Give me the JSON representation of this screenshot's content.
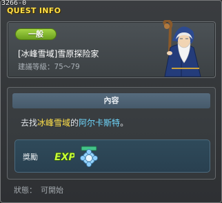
{
  "window": {
    "quest_id": "3266-0",
    "title": "QUEST INFO"
  },
  "header": {
    "category": "一般",
    "quest_name": "[冰峰雪域]雪原探险家",
    "recommend_label": "建議等級：",
    "recommend_range": "75～79",
    "npc_icon": "old-wizard-npc"
  },
  "content": {
    "heading": "內容",
    "text_prefix": "去找",
    "location": "冰峰雪域",
    "text_mid": "的",
    "npc_name": "阿尔卡斯特",
    "text_suffix": "。"
  },
  "reward": {
    "label": "獎勵",
    "exp_icon_text": "EXP",
    "item_icon": "reward-item-icon"
  },
  "status": {
    "label": "狀態：",
    "value": "可開始"
  },
  "colors": {
    "title": "#ffe04a",
    "badge": "#8cc234",
    "location_highlight": "#ffe04a",
    "npc_highlight": "#6fd9ff"
  }
}
